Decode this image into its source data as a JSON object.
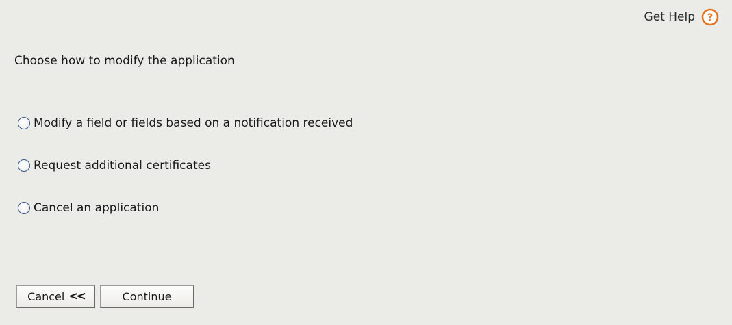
{
  "header": {
    "help_label": "Get Help",
    "help_icon": "help-circle-icon",
    "accent_color": "#e8731e"
  },
  "main": {
    "prompt": "Choose how to modify the application",
    "options": [
      {
        "label": "Modify a field or fields based on a notification received",
        "selected": false
      },
      {
        "label": "Request additional certificates",
        "selected": false
      },
      {
        "label": "Cancel an application",
        "selected": false
      }
    ]
  },
  "footer": {
    "cancel_label": "Cancel",
    "cancel_icon": "double-chevron-left-icon",
    "cancel_glyph": "<<",
    "continue_label": "Continue"
  }
}
